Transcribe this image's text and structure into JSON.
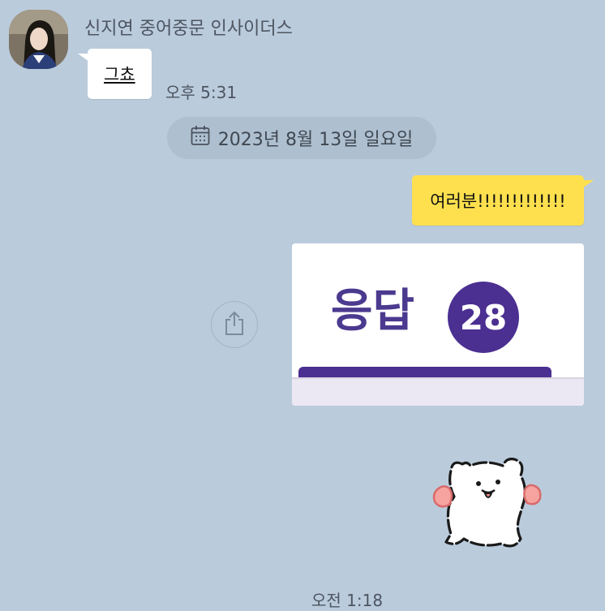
{
  "incoming": {
    "sender_name": "신지연 중어중문 인사이더스",
    "message": "그쵸",
    "time": "오후 5:31"
  },
  "date_divider": {
    "icon": "calendar-icon",
    "label": "2023년 8월 13일 일요일"
  },
  "outgoing": {
    "message": "여러분!!!!!!!!!!!!!",
    "image": {
      "label": "응답",
      "count": "28"
    },
    "share_icon": "share-icon",
    "sticker": "white-puppy-sticker"
  },
  "next_time": "오전 1:18",
  "colors": {
    "background": "#bacbdc",
    "incoming_bubble": "#ffffff",
    "outgoing_bubble": "#fee04e",
    "card_accent": "#4b2f91"
  }
}
